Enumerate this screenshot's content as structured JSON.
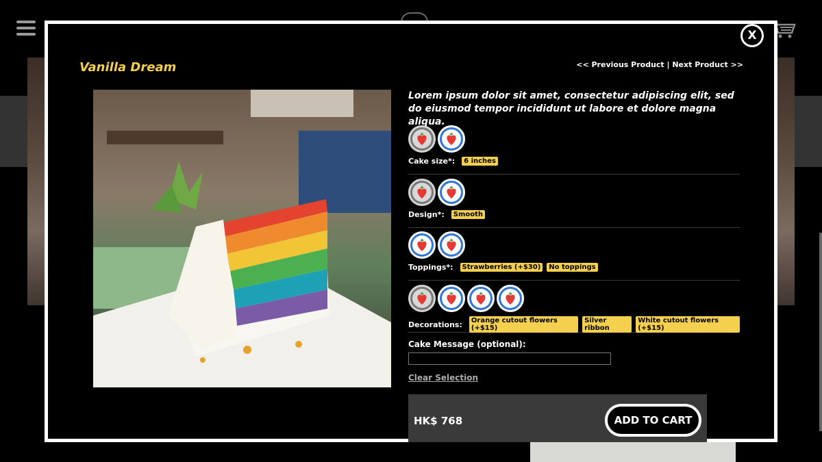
{
  "product": {
    "title": "Vanilla Dream",
    "nav": "<< Previous Product | Next Product >>",
    "description": "Lorem ipsum dolor sit amet, consectetur adipiscing elit, sed do eiusmod tempor incididunt ut labore et dolore magna aliqua.",
    "close_label": "X"
  },
  "options": [
    {
      "label": "Cake size*:",
      "swatches": [
        "unselected",
        "selected"
      ],
      "chips": [
        "6 inches"
      ]
    },
    {
      "label": "Design*:",
      "swatches": [
        "unselected",
        "selected"
      ],
      "chips": [
        "Smooth"
      ]
    },
    {
      "label": "Toppings*:",
      "swatches": [
        "selected",
        "selected"
      ],
      "chips": [
        "Strawberries (+$30)",
        "No toppings"
      ]
    },
    {
      "label": "Decorations:",
      "swatches": [
        "unselected",
        "selected",
        "selected",
        "selected"
      ],
      "chips": [
        "Orange cutout flowers (+$15)",
        "Silver ribbon",
        "White cutout flowers (+$15)"
      ]
    }
  ],
  "message": {
    "label": "Cake Message (optional):",
    "value": "",
    "placeholder": ""
  },
  "clear_label": "Clear Selection",
  "price": "HK$ 768",
  "add_to_cart_label": "ADD TO CART",
  "colors": {
    "accent": "#f5cf4e",
    "selected_swatch": "#2f76d6"
  },
  "icons": {
    "menu": "hamburger-icon",
    "cart": "cart-icon",
    "close": "close-icon",
    "swatch": "strawberry-icon"
  }
}
